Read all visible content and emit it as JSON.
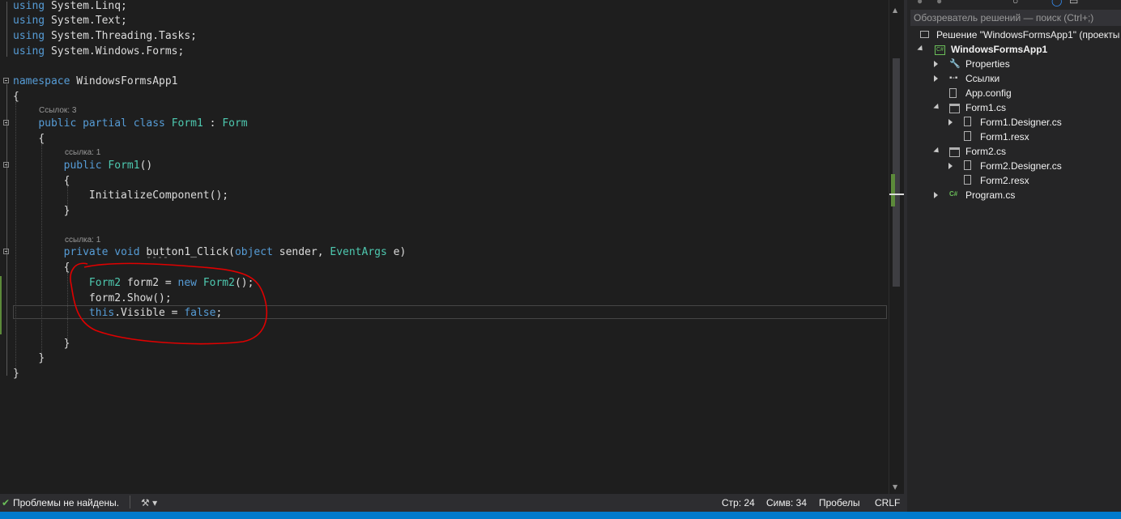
{
  "editor": {
    "usings": [
      {
        "kw": "using",
        "ns": " System.Linq;"
      },
      {
        "kw": "using",
        "ns": " System.Text;"
      },
      {
        "kw": "using",
        "ns": " System.Threading.Tasks;"
      },
      {
        "kw": "using",
        "ns": " System.Windows.Forms;"
      }
    ],
    "namespace_kw": "namespace",
    "namespace_name": " WindowsFormsApp1",
    "open_brace": "{",
    "close_brace": "}",
    "class_lens": "Ссылок: 3",
    "class_kw": "public partial class",
    "class_name": "Form1",
    "class_colon": " : ",
    "class_base": "Form",
    "ctor_lens": "ссылка: 1",
    "ctor_kw": "public",
    "ctor_name": "Form1",
    "ctor_parens": "()",
    "init_call": "InitializeComponent();",
    "method_lens": "ссылка: 1",
    "method_kw": "private void",
    "method_name": " button1_Click(",
    "param1_type": "object",
    "param1_rest": " sender, ",
    "param2_type": "EventArgs",
    "param2_rest": " e)",
    "stmt1_type": "Form2",
    "stmt1_mid": " form2 = ",
    "stmt1_kw": "new",
    "stmt1_type2": "Form2",
    "stmt1_end": "();",
    "stmt2": "form2.Show();",
    "stmt3_kw": "this",
    "stmt3_mid": ".Visible = ",
    "stmt3_val": "false",
    "stmt3_end": ";"
  },
  "statusbar": {
    "problems": "Проблемы не найдены.",
    "line": "Стр: 24",
    "col": "Симв: 34",
    "whitespace": "Пробелы",
    "eol": "CRLF"
  },
  "solution_explorer": {
    "search_placeholder": "Обозреватель решений — поиск (Ctrl+;)",
    "solution_label": "Решение \"WindowsFormsApp1\" (проекты",
    "project": "WindowsFormsApp1",
    "items": [
      {
        "label": "Properties",
        "icon": "wrench-icon"
      },
      {
        "label": "Ссылки",
        "icon": "references-icon"
      },
      {
        "label": "App.config",
        "icon": "config-file-icon"
      },
      {
        "label": "Form1.cs",
        "icon": "form-icon"
      },
      {
        "label": "Form1.Designer.cs",
        "icon": "designer-file-icon"
      },
      {
        "label": "Form1.resx",
        "icon": "resx-file-icon"
      },
      {
        "label": "Form2.cs",
        "icon": "form-icon"
      },
      {
        "label": "Form2.Designer.cs",
        "icon": "designer-file-icon"
      },
      {
        "label": "Form2.resx",
        "icon": "resx-file-icon"
      },
      {
        "label": "Program.cs",
        "icon": "csharp-file-icon"
      }
    ]
  },
  "colors": {
    "keyword": "#569cd6",
    "type": "#4ec9b0",
    "annotation": "#e00000",
    "statusbar": "#007acc"
  }
}
